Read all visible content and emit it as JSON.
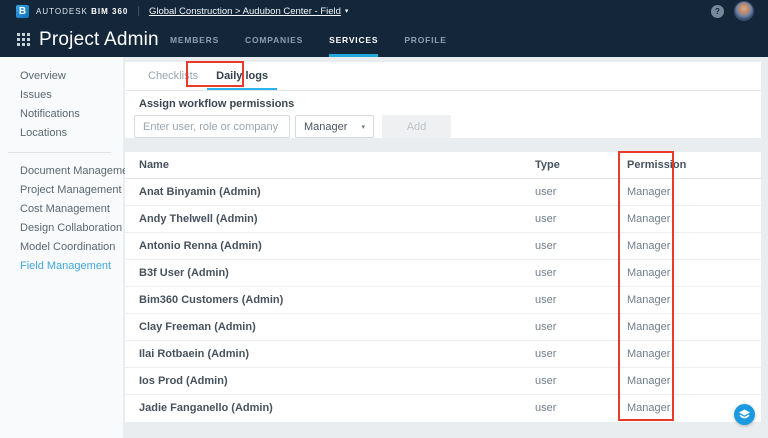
{
  "topbar": {
    "autodesk_label": "AUTODESK",
    "product_label": "BIM 360",
    "breadcrumb": "Global Construction > Audubon Center - Field",
    "help_label": "?"
  },
  "header": {
    "title": "Project Admin",
    "tabs": [
      {
        "label": "MEMBERS"
      },
      {
        "label": "COMPANIES"
      },
      {
        "label": "SERVICES"
      },
      {
        "label": "PROFILE"
      }
    ]
  },
  "sidebar": {
    "group1": [
      {
        "label": "Overview"
      },
      {
        "label": "Issues"
      },
      {
        "label": "Notifications"
      },
      {
        "label": "Locations"
      }
    ],
    "group2": [
      {
        "label": "Document Management"
      },
      {
        "label": "Project Management"
      },
      {
        "label": "Cost Management"
      },
      {
        "label": "Design Collaboration"
      },
      {
        "label": "Model Coordination"
      },
      {
        "label": "Field Management"
      }
    ]
  },
  "content": {
    "tabs": [
      {
        "label": "Checklists"
      },
      {
        "label": "Daily logs"
      }
    ],
    "assign": {
      "label": "Assign workflow permissions",
      "input_placeholder": "Enter user, role or company",
      "role_value": "Manager",
      "add_label": "Add"
    },
    "table": {
      "columns": [
        "Name",
        "Type",
        "Permission"
      ],
      "rows": [
        {
          "name": "Anat Binyamin (Admin)",
          "type": "user",
          "permission": "Manager"
        },
        {
          "name": "Andy Thelwell (Admin)",
          "type": "user",
          "permission": "Manager"
        },
        {
          "name": "Antonio Renna (Admin)",
          "type": "user",
          "permission": "Manager"
        },
        {
          "name": "B3f User (Admin)",
          "type": "user",
          "permission": "Manager"
        },
        {
          "name": "Bim360 Customers (Admin)",
          "type": "user",
          "permission": "Manager"
        },
        {
          "name": "Clay Freeman (Admin)",
          "type": "user",
          "permission": "Manager"
        },
        {
          "name": "Ilai Rotbaein (Admin)",
          "type": "user",
          "permission": "Manager"
        },
        {
          "name": "Ios Prod (Admin)",
          "type": "user",
          "permission": "Manager"
        },
        {
          "name": "Jadie Fanganello (Admin)",
          "type": "user",
          "permission": "Manager"
        }
      ]
    }
  },
  "colors": {
    "navy": "#13263a",
    "accent_cyan": "#1fa8dc",
    "annotation_red": "#e93a2b",
    "sidebar_active_blue": "#3fa7dc"
  }
}
